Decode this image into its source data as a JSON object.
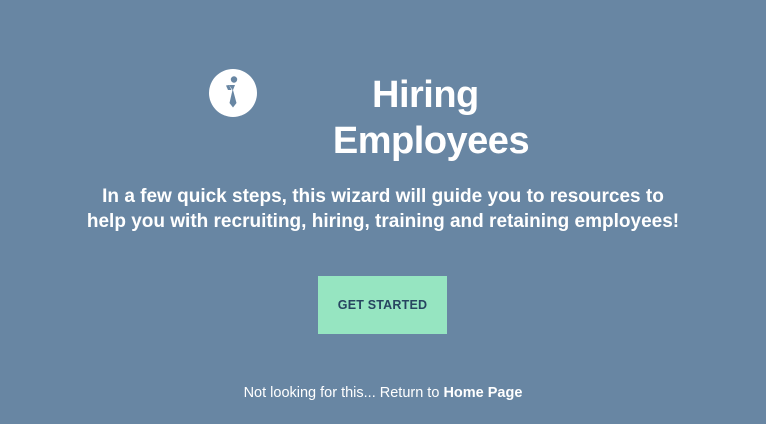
{
  "hero": {
    "icon": "employee-tie-icon",
    "title_line1": "Hiring",
    "title_line2": "Employees",
    "description": "In a few quick steps, this wizard will guide you to resources to help you with recruiting, hiring, training and retaining employees!"
  },
  "cta": {
    "label": "GET STARTED"
  },
  "footer": {
    "text": "Not looking for this... Return to ",
    "link_label": "Home Page"
  },
  "colors": {
    "background": "#6886a3",
    "button": "#96e5c1",
    "button_text": "#274560",
    "text": "#ffffff"
  }
}
